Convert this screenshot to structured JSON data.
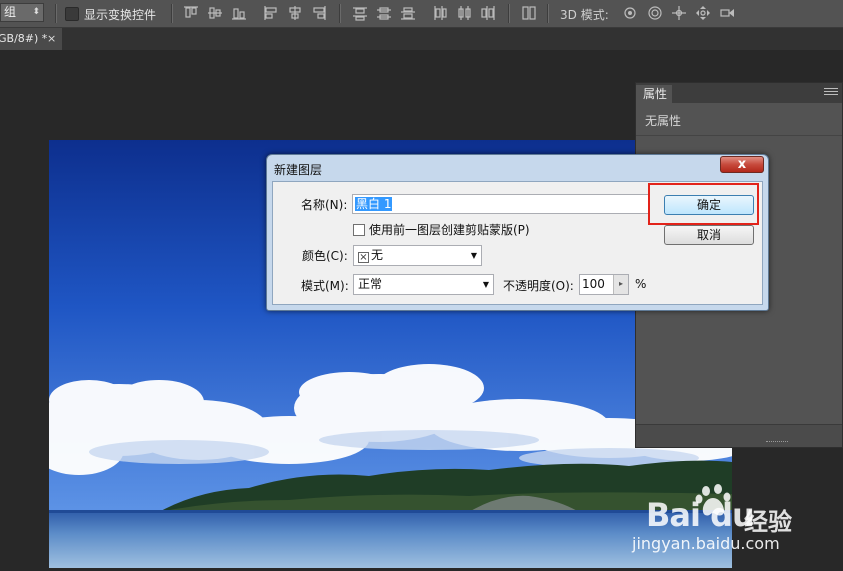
{
  "options_bar": {
    "group_select": "组",
    "show_transform_label": "显示变换控件",
    "mode_3d_label": "3D 模式:"
  },
  "doc_tab": {
    "title": "GB/8#) *",
    "close": "×"
  },
  "properties_panel": {
    "tab_label": "属性",
    "empty_text": "无属性"
  },
  "dialog": {
    "title": "新建图层",
    "close_glyph": "x",
    "name_label": "名称(N):",
    "name_value": "黑白 1",
    "clip_label": "使用前一图层创建剪贴蒙版(P)",
    "color_label": "颜色(C):",
    "color_value": "无",
    "mode_label": "模式(M):",
    "mode_value": "正常",
    "opacity_label": "不透明度(O):",
    "opacity_value": "100",
    "opacity_unit": "%",
    "ok_label": "确定",
    "cancel_label": "取消"
  },
  "watermark": {
    "logo_text": "Bai du",
    "logo_cn": "经验",
    "url": "jingyan.baidu.com"
  },
  "colors": {
    "highlight": "#e2231a",
    "dialog_frame": "#c6d8ec",
    "workspace": "#282828"
  }
}
